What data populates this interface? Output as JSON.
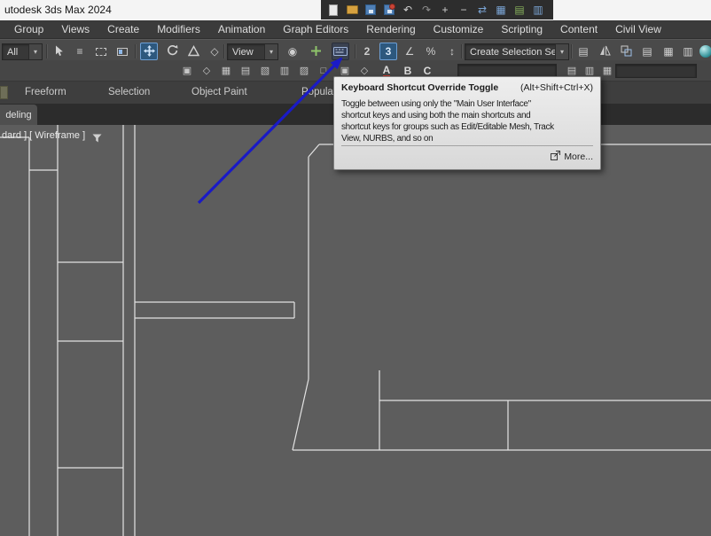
{
  "window": {
    "title": "utodesk 3ds Max 2024"
  },
  "menu": {
    "items": [
      "Group",
      "Views",
      "Create",
      "Modifiers",
      "Animation",
      "Graph Editors",
      "Rendering",
      "Customize",
      "Scripting",
      "Content",
      "Civil View"
    ]
  },
  "toolbar": {
    "selection_filter_value": "All",
    "ref_coord_value": "View",
    "selection_set_value": "Create Selection Se",
    "snap2_label": "2",
    "snap3_label": "3"
  },
  "toolbar2": {
    "letters": [
      "A",
      "B",
      "C"
    ]
  },
  "ribbon": {
    "tabs": [
      "Freeform",
      "Selection",
      "Object Paint",
      "Populate"
    ],
    "modeling_tab_label": "deling"
  },
  "viewport": {
    "label": "dard ] [ Wireframe ]"
  },
  "tooltip": {
    "title": "Keyboard Shortcut Override Toggle",
    "shortcut": "(Alt+Shift+Ctrl+X)",
    "body_lines": [
      "Toggle between using only the \"Main User Interface\"",
      "shortcut keys and using both the main shortcuts and",
      "shortcut keys for groups such as Edit/Editable Mesh, Track",
      "View, NURBS, and so on"
    ],
    "more_label": "More..."
  },
  "icons": {
    "dropdown_arrow": "▾",
    "select_by_name": "≡",
    "use_center": "◉",
    "angle_snap": "∠",
    "percent_snap": "%",
    "spinner_snap": "↕",
    "undo": "↶",
    "redo": "↷",
    "plus": "+",
    "minus": "−",
    "swap": "⇄",
    "grid": "▦",
    "rows": "▤",
    "cols": "▥",
    "panel": "▣",
    "diamond": "◇",
    "shade": "▧",
    "hatch": "▨",
    "box": "□"
  },
  "colors": {
    "toolbar_highlight": "#2d587e",
    "pointer_arrow": "#1a1ac6",
    "tooltip_bg": "#e4e4e4",
    "viewport_bg": "#5d5d5d"
  }
}
